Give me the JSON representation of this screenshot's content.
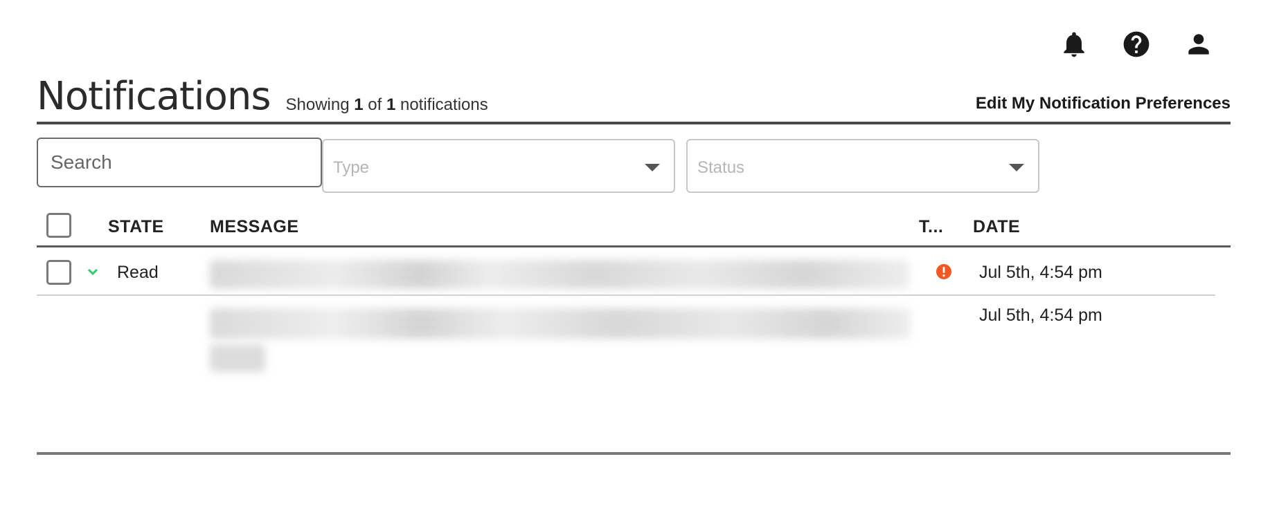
{
  "top_icons": {
    "notifications": "bell-icon",
    "help": "help-icon",
    "account": "user-icon"
  },
  "header": {
    "title": "Notifications",
    "showing_prefix": "Showing",
    "showing_count": "1",
    "showing_of": "of",
    "showing_total": "1",
    "showing_suffix": "notifications",
    "edit_prefs_label": "Edit My Notification Preferences"
  },
  "filters": {
    "search_placeholder": "Search",
    "type_placeholder": "Type",
    "status_placeholder": "Status"
  },
  "table": {
    "columns": {
      "state": "STATE",
      "message": "MESSAGE",
      "type": "T...",
      "date": "DATE"
    },
    "rows": [
      {
        "state": "Read",
        "type_icon": "alert-icon",
        "type_color": "#f05a22",
        "date": "Jul 5th, 4:54 pm",
        "expanded_date": "Jul 5th, 4:54 pm"
      }
    ]
  },
  "colors": {
    "chevron": "#2ecc71",
    "alert": "#f05a22",
    "divider": "#4a4a4a"
  }
}
